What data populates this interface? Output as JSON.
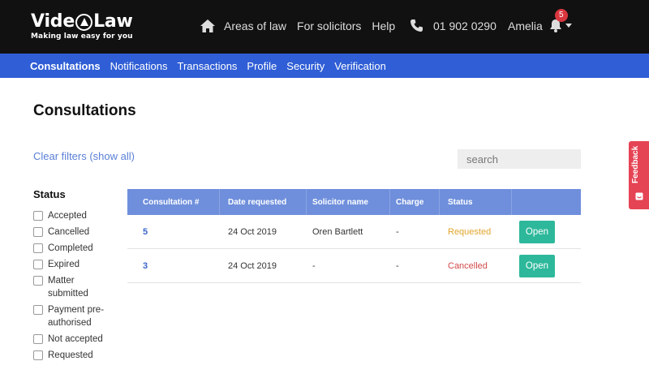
{
  "header": {
    "logo_title_part1": "Vide",
    "logo_title_part2": "Law",
    "logo_tagline": "Making law easy for you",
    "nav": [
      "Areas of law",
      "For solicitors",
      "Help"
    ],
    "phone": "01 902 0290",
    "user_name": "Amelia",
    "notification_count": "5"
  },
  "subnav": {
    "tabs": [
      "Consultations",
      "Notifications",
      "Transactions",
      "Profile",
      "Security",
      "Verification"
    ],
    "active_tab": "Consultations"
  },
  "main": {
    "title": "Consultations",
    "clear_filters": "Clear filters (show all)",
    "search_placeholder": "search"
  },
  "filters": {
    "heading": "Status",
    "options": [
      "Accepted",
      "Cancelled",
      "Completed",
      "Expired",
      "Matter submitted",
      "Payment pre-authorised",
      "Not accepted",
      "Requested"
    ]
  },
  "table": {
    "columns": [
      "Consultation #",
      "Date requested",
      "Solicitor name",
      "Charge",
      "Status",
      ""
    ],
    "rows": [
      {
        "number": "5",
        "date": "24 Oct 2019",
        "solicitor": "Oren Bartlett",
        "charge": "-",
        "status": "Requested",
        "action": "Open"
      },
      {
        "number": "3",
        "date": "24 Oct 2019",
        "solicitor": "-",
        "charge": "-",
        "status": "Cancelled",
        "action": "Open"
      }
    ]
  },
  "feedback": {
    "label": "Feedback"
  },
  "colors": {
    "header_bg": "#111111",
    "subnav_bg": "#2f5ed6",
    "table_header_bg": "#6f8fdc",
    "open_button": "#2db89b",
    "status_requested": "#e0a52c",
    "status_cancelled": "#d24a4a",
    "feedback_bg": "#e54454",
    "badge_bg": "#d9363e"
  },
  "icons": [
    "home-icon",
    "phone-icon",
    "bell-icon",
    "chevron-down-icon",
    "feedback-icon"
  ]
}
